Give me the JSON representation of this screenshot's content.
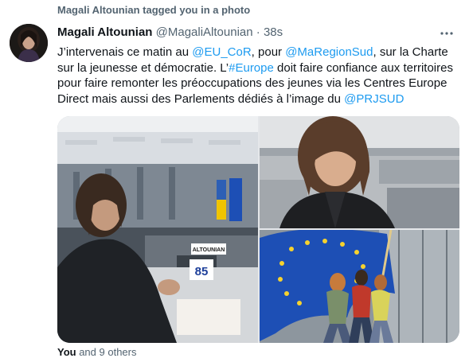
{
  "social_context": "Magali Altounian tagged you in a photo",
  "tweet": {
    "display_name": "Magali Altounian",
    "handle": "@MagaliAltounian",
    "separator": "·",
    "time": "38s",
    "text": {
      "p1": "J’intervenais ce matin au ",
      "m1": "@EU_CoR",
      "p2": ", pour ",
      "m2": "@MaRegionSud",
      "p3": ", sur la Charte sur la jeunesse et démocratie. L’",
      "h1": "#Europe",
      "p4": " doit faire confiance aux territoires pour faire remonter les préoccupations des jeunes via les Centres Europe Direct mais aussi des Parlements dédiés à l’image du ",
      "m3": "@PRJSUD"
    }
  },
  "photos": {
    "left_desk_label": "ALTOUNIAN",
    "left_seat_number": "85"
  },
  "likes": {
    "lead": "You",
    "rest": " and 9 others"
  },
  "icons": {
    "more": "more-horizontal-icon"
  },
  "colors": {
    "link": "#1d9bf0",
    "secondary_text": "#536471",
    "primary_text": "#0f1419",
    "eu_blue": "#1d4fb5",
    "eu_gold": "#f6d22e"
  }
}
